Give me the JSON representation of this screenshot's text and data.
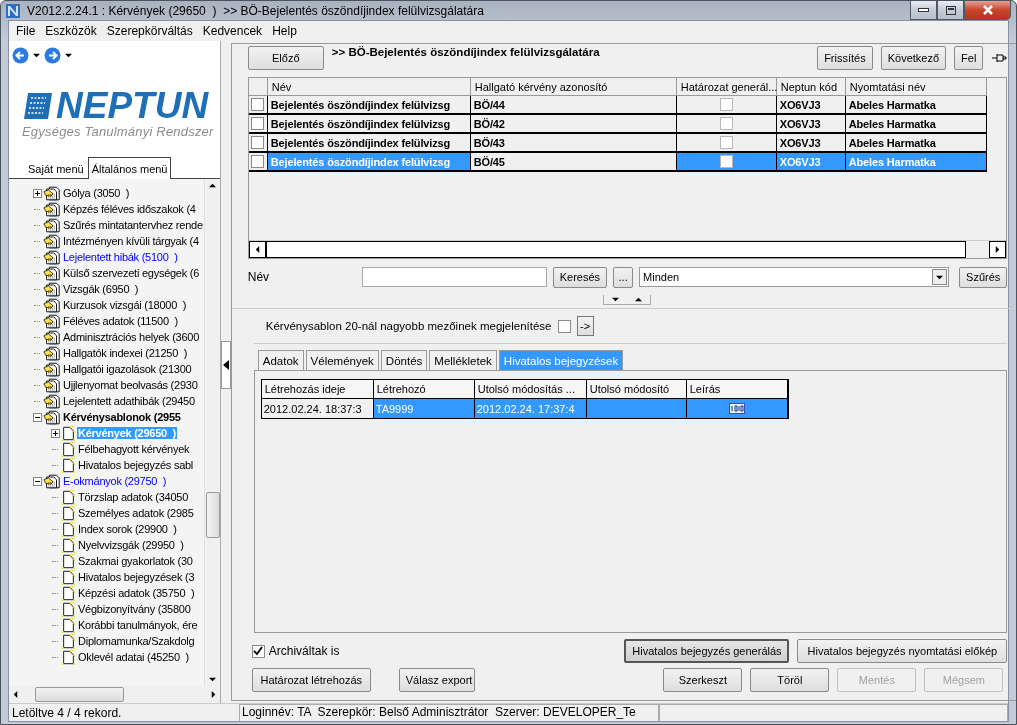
{
  "window": {
    "title": "V2012.2.24.1 : Kérvények (29650  )  >> BÖ-Bejelentés öszöndíjindex felülvizsgálatára"
  },
  "menu": [
    "File",
    "Eszközök",
    "Szerepkörváltás",
    "Kedvencek",
    "Help"
  ],
  "sidebar": {
    "logo": {
      "name": "NEPTUN",
      "tagline": "Egységes Tanulmányi Rendszer"
    },
    "tabs": [
      {
        "label": "Saját menü",
        "selected": false
      },
      {
        "label": "Általános menü",
        "selected": true
      }
    ],
    "tree": [
      {
        "label": "Gólya (3050  )",
        "kind": "item",
        "expanded": false,
        "selected": false,
        "bold": false
      },
      {
        "label": "Képzés féléves időszakok (4",
        "kind": "item",
        "selected": false,
        "bold": false
      },
      {
        "label": "Szűrés mintatantervhez rende",
        "kind": "item",
        "selected": false,
        "bold": false
      },
      {
        "label": "Intézményen kívüli tárgyak (4",
        "kind": "item",
        "selected": false,
        "bold": false
      },
      {
        "label": "Lejelentett hibák (5100  )",
        "kind": "link",
        "selected": false,
        "bold": false
      },
      {
        "label": "Külső szervezeti egységek (6",
        "kind": "item",
        "selected": false,
        "bold": false
      },
      {
        "label": "Vizsgák (6950  )",
        "kind": "item",
        "selected": false,
        "bold": false
      },
      {
        "label": "Kurzusok vizsgái (18000  )",
        "kind": "item",
        "selected": false,
        "bold": false
      },
      {
        "label": "Féléves adatok (11500  )",
        "kind": "item",
        "selected": false,
        "bold": false
      },
      {
        "label": "Adminisztrációs helyek (3600",
        "kind": "item",
        "selected": false,
        "bold": false
      },
      {
        "label": "Hallgatók indexei (21250  )",
        "kind": "item",
        "selected": false,
        "bold": false
      },
      {
        "label": "Hallgatói igazolások (21300",
        "kind": "item",
        "selected": false,
        "bold": false
      },
      {
        "label": "Ujjlenyomat beolvasás (2930",
        "kind": "item",
        "selected": false,
        "bold": false
      },
      {
        "label": "Lejelentett adathibák (29450",
        "kind": "item",
        "selected": false,
        "bold": false
      },
      {
        "label": "Kérvénysablonok (2955",
        "kind": "item",
        "expanded": true,
        "selected": false,
        "bold": true,
        "children": [
          {
            "label": "Kérvények (29650  )",
            "kind": "item",
            "expanded": false,
            "selected": true,
            "bold": true
          },
          {
            "label": "Félbehagyott kérvények",
            "kind": "item",
            "selected": false,
            "bold": false
          },
          {
            "label": "Hivatalos bejegyzés sabl",
            "kind": "item",
            "selected": false,
            "bold": false
          }
        ]
      },
      {
        "label": "E-okmányok (29750  )",
        "kind": "link",
        "expanded": true,
        "selected": false,
        "bold": false,
        "children": [
          {
            "label": "Törzslap adatok (34050",
            "kind": "item",
            "selected": false,
            "bold": false
          },
          {
            "label": "Személyes adatok (2985",
            "kind": "item",
            "selected": false,
            "bold": false
          },
          {
            "label": "Index sorok (29900  )",
            "kind": "item",
            "selected": false,
            "bold": false
          },
          {
            "label": "Nyelvvizsgák (29950  )",
            "kind": "item",
            "selected": false,
            "bold": false
          },
          {
            "label": "Szakmai gyakorlatok (30",
            "kind": "item",
            "selected": false,
            "bold": false
          },
          {
            "label": "Hivatalos bejegyzések (3",
            "kind": "item",
            "selected": false,
            "bold": false
          },
          {
            "label": "Képzési adatok (35750  )",
            "kind": "item",
            "selected": false,
            "bold": false
          },
          {
            "label": "Végbizonyítvány (35800",
            "kind": "item",
            "selected": false,
            "bold": false
          },
          {
            "label": "Korábbi tanulmányok, ére",
            "kind": "item",
            "selected": false,
            "bold": false
          },
          {
            "label": "Diplomamunka/Szakdolg",
            "kind": "item",
            "selected": false,
            "bold": false
          },
          {
            "label": "Oklevél adatai (45250  )",
            "kind": "item",
            "selected": false,
            "bold": false
          }
        ]
      }
    ]
  },
  "record": {
    "prev_button": "Előző",
    "title": ">> BÖ-Bejelentés öszöndíjindex felülvizsgálatára",
    "buttons": [
      "Frissítés",
      "Következő",
      "Fel"
    ]
  },
  "table": {
    "columns": [
      "Név",
      "Hallgató kérvény azonosító",
      "Határozat generál...",
      "Neptun kód",
      "Nyomtatási név"
    ],
    "rows": [
      {
        "checked": false,
        "name": "Bejelentés öszöndíjindex felülvizsg",
        "id": "BÖ/44",
        "decision": false,
        "neptun": "XO6VJ3",
        "print_name": "Abeles Harmatka",
        "selected": false
      },
      {
        "checked": false,
        "name": "Bejelentés öszöndíjindex felülvizsg",
        "id": "BÖ/42",
        "decision": false,
        "neptun": "XO6VJ3",
        "print_name": "Abeles Harmatka",
        "selected": false
      },
      {
        "checked": false,
        "name": "Bejelentés öszöndíjindex felülvizsg",
        "id": "BÖ/43",
        "decision": false,
        "neptun": "XO6VJ3",
        "print_name": "Abeles Harmatka",
        "selected": false
      },
      {
        "checked": false,
        "name": "Bejelentés öszöndíjindex felülvizsg",
        "id": "BÖ/45",
        "decision": false,
        "neptun": "XO6VJ3",
        "print_name": "Abeles Harmatka",
        "selected": true
      }
    ]
  },
  "filter": {
    "label": "Név",
    "search_button": "Keresés",
    "more_button": "...",
    "scope": "Minden",
    "filter_button": "Szűrés"
  },
  "option": {
    "label": "Kérvénysablon 20-nál nagyobb mezőinek megjelenítése",
    "checked": false,
    "go_button": "->"
  },
  "detail_tabs": [
    {
      "label": "Adatok",
      "selected": false
    },
    {
      "label": "Vélemények",
      "selected": false
    },
    {
      "label": "Döntés",
      "selected": false
    },
    {
      "label": "Mellékletek",
      "selected": false
    },
    {
      "label": "Hivatalos bejegyzések",
      "selected": true
    }
  ],
  "entries": {
    "columns": [
      "Létrehozás ideje",
      "Létrehozó",
      "Utolsó módosítás ...",
      "Utolsó módosító",
      "Leírás"
    ],
    "rows": [
      {
        "created": "2012.02.24. 18:37:3",
        "creator": "TA9999",
        "modified": "2012.02.24. 17:37:4",
        "selected": true
      }
    ]
  },
  "archived": {
    "label": "Archiváltak is",
    "checked": true
  },
  "entry_buttons": [
    {
      "label": "Hivatalos bejegyzés generálás",
      "disabled": false,
      "default": true
    },
    {
      "label": "Hivatalos bejegyzés nyomtatási előkép",
      "disabled": false,
      "default": false
    }
  ],
  "left_buttons": [
    {
      "label": "Határozat létrehozás",
      "disabled": false
    },
    {
      "label": "Válasz export",
      "disabled": false
    }
  ],
  "right_buttons": [
    {
      "label": "Szerkeszt",
      "disabled": false
    },
    {
      "label": "Töröl",
      "disabled": false
    },
    {
      "label": "Mentés",
      "disabled": true
    },
    {
      "label": "Mégsem",
      "disabled": true
    }
  ],
  "status_bar": {
    "records": "Letöltve 4 / 4 rekord.",
    "session": "Loginnév: TA  Szerepkör: Belső Adminisztrátor  Szerver: DEVELOPER_Te"
  }
}
